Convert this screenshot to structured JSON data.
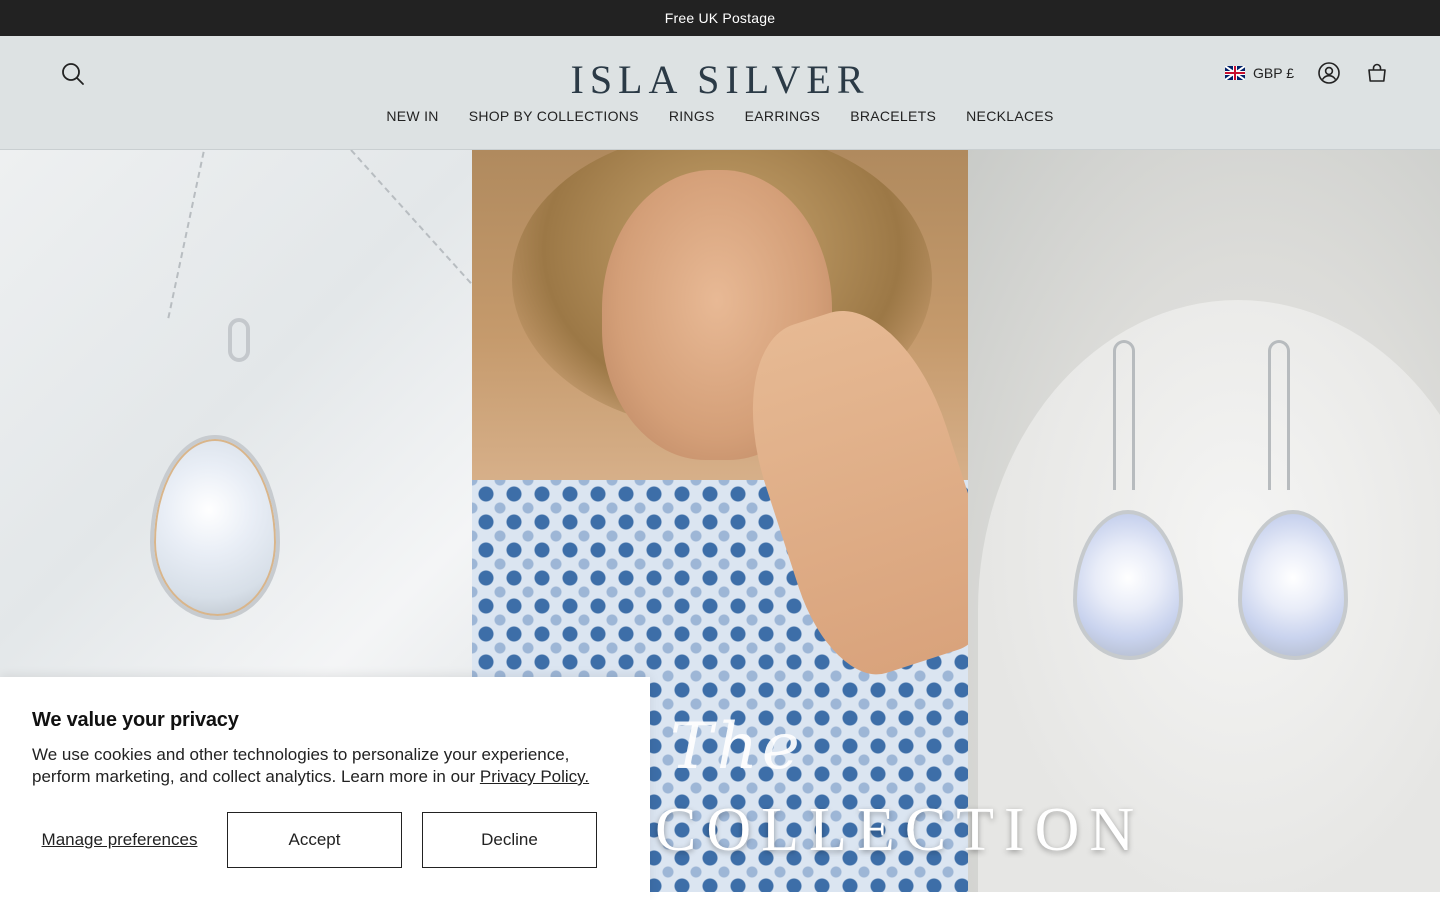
{
  "announcement": {
    "text": "Free UK Postage"
  },
  "header": {
    "logo_text": "ISLA SILVER",
    "currency": {
      "label": "GBP £",
      "flag": "uk-flag-icon"
    },
    "icons": {
      "search": "search-icon",
      "account": "account-icon",
      "cart": "bag-icon"
    }
  },
  "nav": {
    "items": [
      {
        "label": "NEW IN"
      },
      {
        "label": "SHOP BY COLLECTIONS"
      },
      {
        "label": "RINGS"
      },
      {
        "label": "EARRINGS"
      },
      {
        "label": "BRACELETS"
      },
      {
        "label": "NECKLACES"
      }
    ]
  },
  "hero": {
    "script_text": "The",
    "title_text": "COLLECTION"
  },
  "cookie_banner": {
    "title": "We value your privacy",
    "body": "We use cookies and other technologies to personalize your experience, perform marketing, and collect analytics. Learn more in our ",
    "privacy_link": "Privacy Policy.",
    "manage_label": "Manage preferences",
    "accept_label": "Accept",
    "decline_label": "Decline"
  },
  "colors": {
    "announcement_bg": "#222222",
    "header_bg": "#dde2e3",
    "logo": "#2b3a46"
  }
}
